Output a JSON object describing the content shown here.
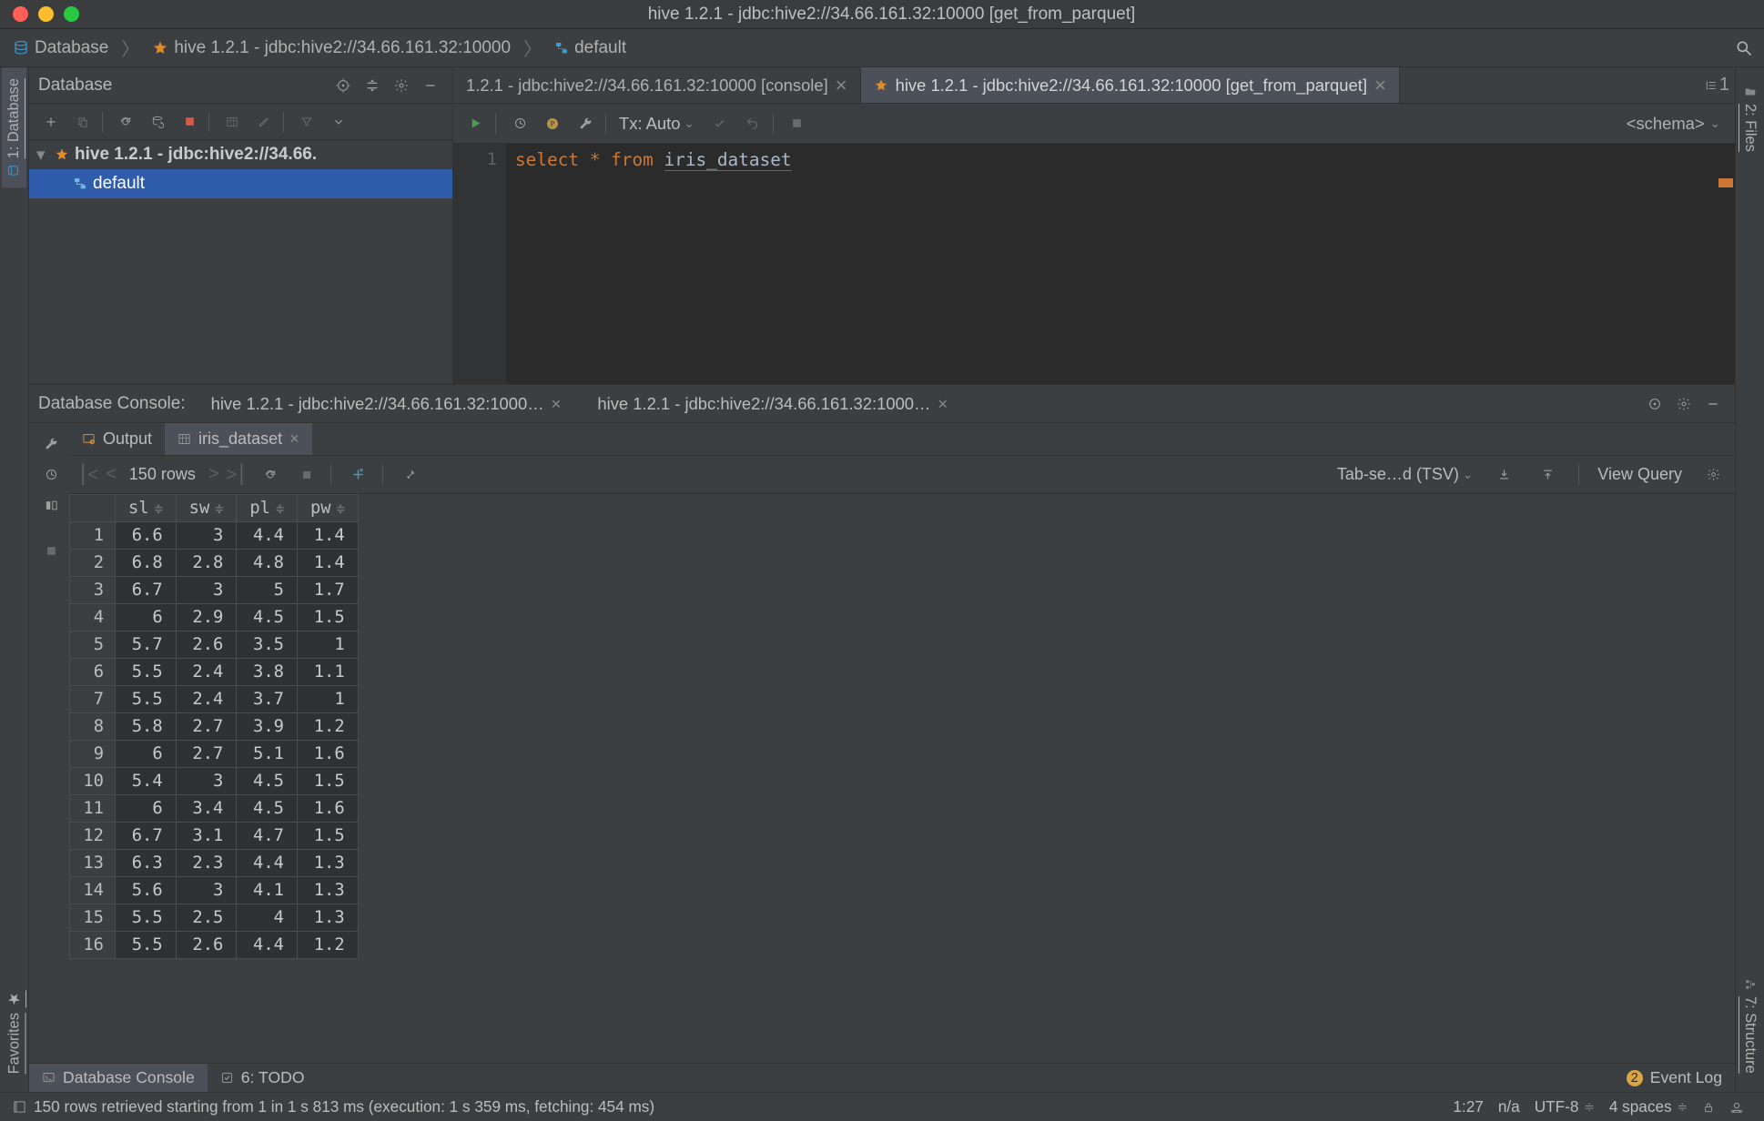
{
  "window": {
    "title": "hive 1.2.1 - jdbc:hive2://34.66.161.32:10000 [get_from_parquet]"
  },
  "breadcrumb": {
    "root": "Database",
    "conn": "hive 1.2.1 - jdbc:hive2://34.66.161.32:10000",
    "schema": "default"
  },
  "left_gutter": {
    "database_tab": "1: Database",
    "favorites_tab": "Favorites"
  },
  "right_gutter": {
    "files_tab": "2: Files",
    "structure_tab": "7: Structure"
  },
  "db_panel": {
    "title": "Database",
    "tree": {
      "datasource": "hive 1.2.1 - jdbc:hive2://34.66.",
      "schema": "default"
    }
  },
  "editor": {
    "tabs": [
      {
        "label": "1.2.1 - jdbc:hive2://34.66.161.32:10000 [console]",
        "active": false
      },
      {
        "label": "hive 1.2.1 - jdbc:hive2://34.66.161.32:10000 [get_from_parquet]",
        "active": true
      }
    ],
    "members_count": "1",
    "tx_label": "Tx: Auto",
    "schema_label": "<schema>",
    "line_no": "1",
    "sql": {
      "kw_select": "select",
      "star": "*",
      "kw_from": "from",
      "table": "iris_dataset"
    }
  },
  "console": {
    "title": "Database Console:",
    "tabs": [
      "hive 1.2.1 - jdbc:hive2://34.66.161.32:1000…",
      "hive 1.2.1 - jdbc:hive2://34.66.161.32:1000…"
    ],
    "result_tabs": {
      "output": "Output",
      "dataset": "iris_dataset"
    },
    "row_count_label": "150 rows",
    "format_label": "Tab-se…d (TSV)",
    "view_query": "View Query",
    "columns": [
      "sl",
      "sw",
      "pl",
      "pw"
    ],
    "rows": [
      [
        "6.6",
        "3",
        "4.4",
        "1.4"
      ],
      [
        "6.8",
        "2.8",
        "4.8",
        "1.4"
      ],
      [
        "6.7",
        "3",
        "5",
        "1.7"
      ],
      [
        "6",
        "2.9",
        "4.5",
        "1.5"
      ],
      [
        "5.7",
        "2.6",
        "3.5",
        "1"
      ],
      [
        "5.5",
        "2.4",
        "3.8",
        "1.1"
      ],
      [
        "5.5",
        "2.4",
        "3.7",
        "1"
      ],
      [
        "5.8",
        "2.7",
        "3.9",
        "1.2"
      ],
      [
        "6",
        "2.7",
        "5.1",
        "1.6"
      ],
      [
        "5.4",
        "3",
        "4.5",
        "1.5"
      ],
      [
        "6",
        "3.4",
        "4.5",
        "1.6"
      ],
      [
        "6.7",
        "3.1",
        "4.7",
        "1.5"
      ],
      [
        "6.3",
        "2.3",
        "4.4",
        "1.3"
      ],
      [
        "5.6",
        "3",
        "4.1",
        "1.3"
      ],
      [
        "5.5",
        "2.5",
        "4",
        "1.3"
      ],
      [
        "5.5",
        "2.6",
        "4.4",
        "1.2"
      ]
    ]
  },
  "toolstrip": {
    "db_console": "Database Console",
    "todo": "6: TODO",
    "event_badge": "2",
    "event_log": "Event Log"
  },
  "status": {
    "msg": "150 rows retrieved starting from 1 in 1 s 813 ms (execution: 1 s 359 ms, fetching: 454 ms)",
    "pos": "1:27",
    "na": "n/a",
    "enc": "UTF-8",
    "indent": "4 spaces"
  }
}
